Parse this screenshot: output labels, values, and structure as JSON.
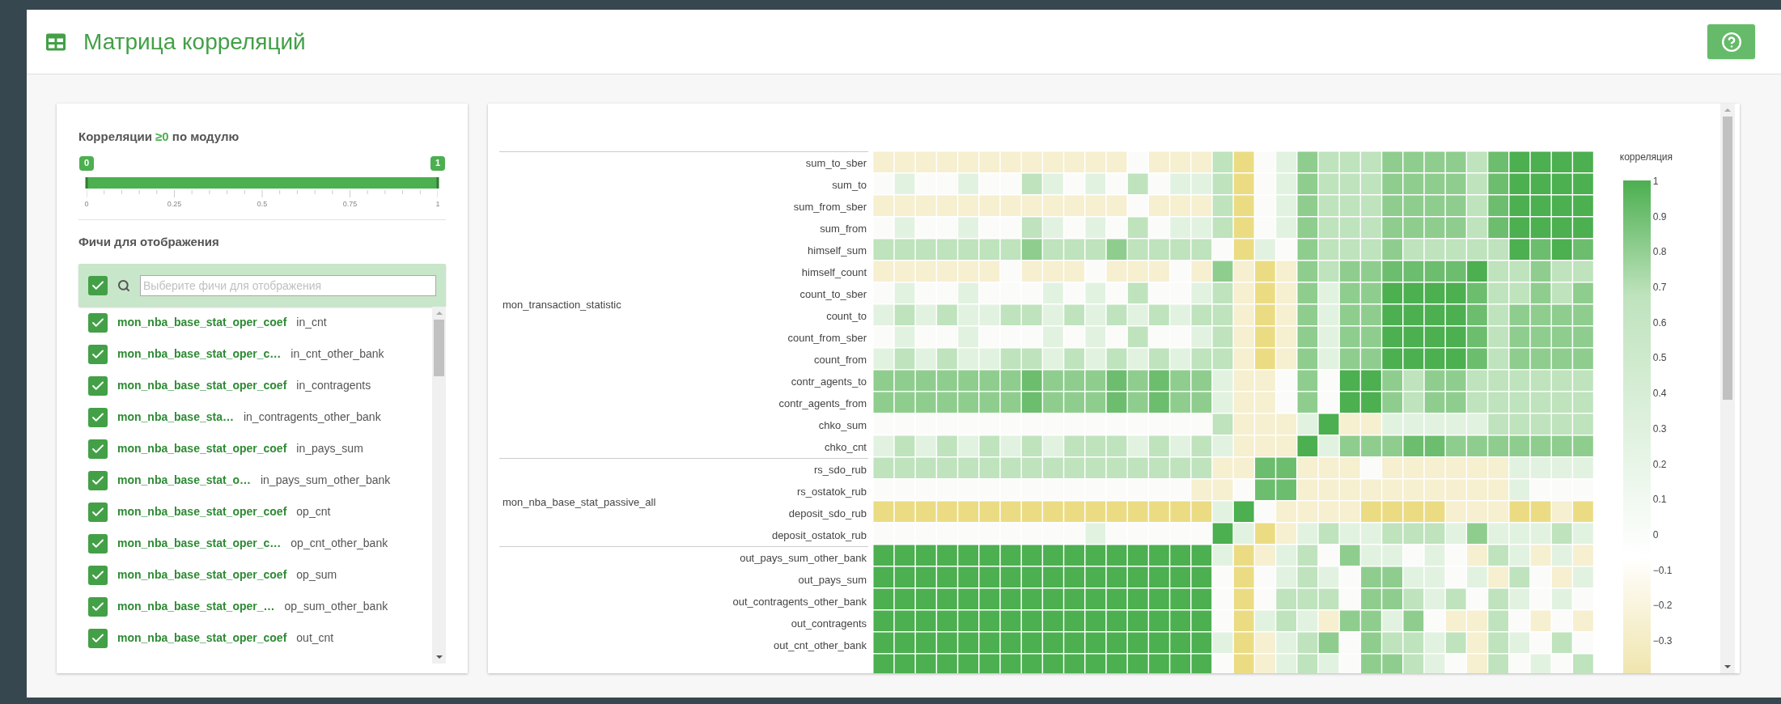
{
  "header": {
    "title": "Матрица корреляций"
  },
  "filter": {
    "title_prefix": "Корреляции",
    "title_value": "≥0",
    "title_suffix": "по модулю",
    "slider": {
      "low": {
        "level": 0,
        "label": "0"
      },
      "high": {
        "level": 1,
        "label": "1"
      },
      "ticks": [
        "0",
        "0.25",
        "0.5",
        "0.75",
        "1"
      ]
    }
  },
  "features": {
    "title": "Фичи для отображения",
    "select_all_checked": true,
    "search": {
      "placeholder": "Выберите фичи для отображения"
    },
    "items": [
      {
        "group": "mon_nba_base_stat_oper_coef",
        "feature": "in_cnt",
        "checked": true
      },
      {
        "group": "mon_nba_base_stat_oper_c…",
        "feature": "in_cnt_other_bank",
        "checked": true
      },
      {
        "group": "mon_nba_base_stat_oper_coef",
        "feature": "in_contragents",
        "checked": true
      },
      {
        "group": "mon_nba_base_sta…",
        "feature": "in_contragents_other_bank",
        "checked": true
      },
      {
        "group": "mon_nba_base_stat_oper_coef",
        "feature": "in_pays_sum",
        "checked": true
      },
      {
        "group": "mon_nba_base_stat_o…",
        "feature": "in_pays_sum_other_bank",
        "checked": true
      },
      {
        "group": "mon_nba_base_stat_oper_coef",
        "feature": "op_cnt",
        "checked": true
      },
      {
        "group": "mon_nba_base_stat_oper_c…",
        "feature": "op_cnt_other_bank",
        "checked": true
      },
      {
        "group": "mon_nba_base_stat_oper_coef",
        "feature": "op_sum",
        "checked": true
      },
      {
        "group": "mon_nba_base_stat_oper_…",
        "feature": "op_sum_other_bank",
        "checked": true
      },
      {
        "group": "mon_nba_base_stat_oper_coef",
        "feature": "out_cnt",
        "checked": true
      }
    ]
  },
  "heatmap": {
    "groups": [
      {
        "label": "mon_transaction_statistic",
        "rows": [
          "sum_to_sber",
          "sum_to",
          "sum_from_sber",
          "sum_from",
          "himself_sum",
          "himself_count",
          "count_to_sber",
          "count_to",
          "count_from_sber",
          "count_from",
          "contr_agents_to",
          "contr_agents_from",
          "chko_sum",
          "chko_cnt"
        ]
      },
      {
        "label": "mon_nba_base_stat_passive_all",
        "rows": [
          "rs_sdo_rub",
          "rs_ostatok_rub",
          "deposit_sdo_rub",
          "deposit_ostatok_rub"
        ]
      },
      {
        "rows": [
          "out_pays_sum_other_bank",
          "out_pays_sum",
          "out_contragents_other_bank",
          "out_contragents",
          "out_cnt_other_bank"
        ]
      }
    ],
    "colorbar": {
      "title": "корреляция",
      "ticks": [
        "1",
        "0.9",
        "0.8",
        "0.7",
        "0.6",
        "0.5",
        "0.4",
        "0.3",
        "0.2",
        "0.1",
        "0",
        "−0.1",
        "−0.2",
        "−0.3"
      ]
    }
  }
}
